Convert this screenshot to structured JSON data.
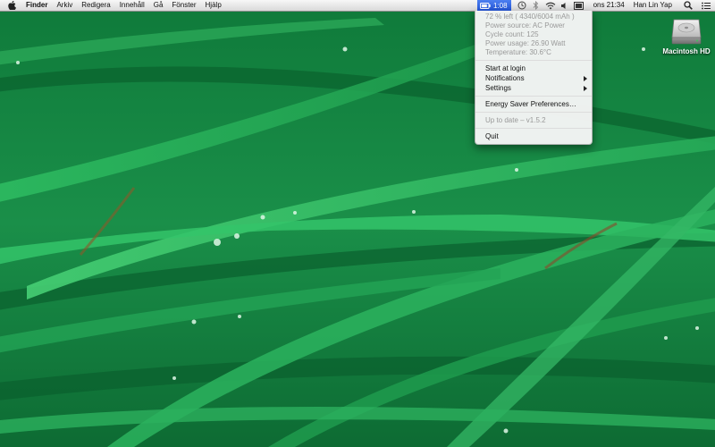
{
  "menubar": {
    "app_name": "Finder",
    "menus": [
      "Arkiv",
      "Redigera",
      "Innehåll",
      "Gå",
      "Fönster",
      "Hjälp"
    ],
    "battery_time": "1:08",
    "clock": "ons 21:34",
    "user": "Han Lin Yap",
    "highlight_color": "#2f64e0"
  },
  "battery_menu": {
    "info": [
      "72 % left ( 4340/6004 mAh )",
      "Power source: AC Power",
      "Cycle count: 125",
      "Power usage: 26.90 Watt",
      "Temperature: 30.6°C"
    ],
    "items": {
      "start_at_login": "Start at login",
      "notifications": "Notifications",
      "settings": "Settings",
      "energy_saver": "Energy Saver Preferences…",
      "update_status": "Up to date – v1.5.2",
      "quit": "Quit"
    }
  },
  "desktop": {
    "drive_label": "Macintosh HD",
    "wallpaper": "green-grass-with-water-drops"
  }
}
